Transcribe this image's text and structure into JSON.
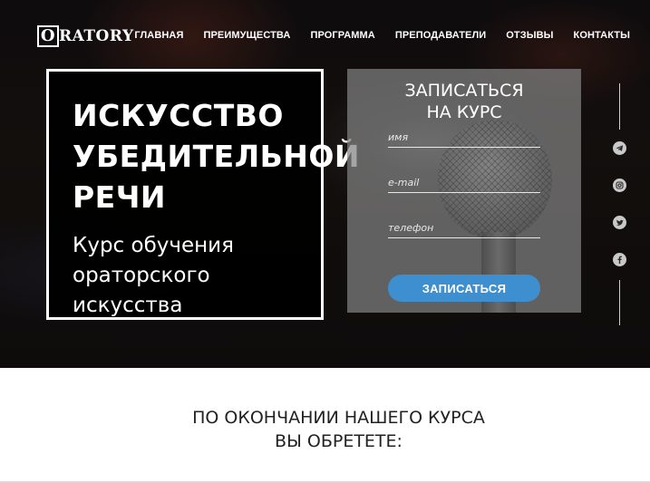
{
  "header": {
    "logo_initial": "O",
    "logo_rest": "RATORY",
    "nav": [
      {
        "label": "ГЛАВНАЯ"
      },
      {
        "label": "ПРЕИМУЩЕСТВА"
      },
      {
        "label": "ПРОГРАММА"
      },
      {
        "label": "ПРЕПОДАВАТЕЛИ"
      },
      {
        "label": "ОТЗЫВЫ"
      },
      {
        "label": "КОНТАКТЫ"
      }
    ]
  },
  "hero": {
    "headline": "ИСКУССТВО\nУБЕДИТЕЛЬНОЙ\nРЕЧИ",
    "subline": "Курс обучения\nораторского\nискусства"
  },
  "form": {
    "title": "ЗАПИСАТЬСЯ\nНА КУРС",
    "name_placeholder": "имя",
    "email_placeholder": "e-mail",
    "phone_placeholder": "телефон",
    "submit_label": "ЗАПИСАТЬСЯ",
    "accent_color": "#3d8fd0"
  },
  "social": {
    "icons": [
      "telegram-icon",
      "instagram-icon",
      "twitter-icon",
      "facebook-icon"
    ]
  },
  "results": {
    "title": "ПО ОКОНЧАНИИ НАШЕГО КУРСА\nВЫ ОБРЕТЕТЕ:"
  }
}
